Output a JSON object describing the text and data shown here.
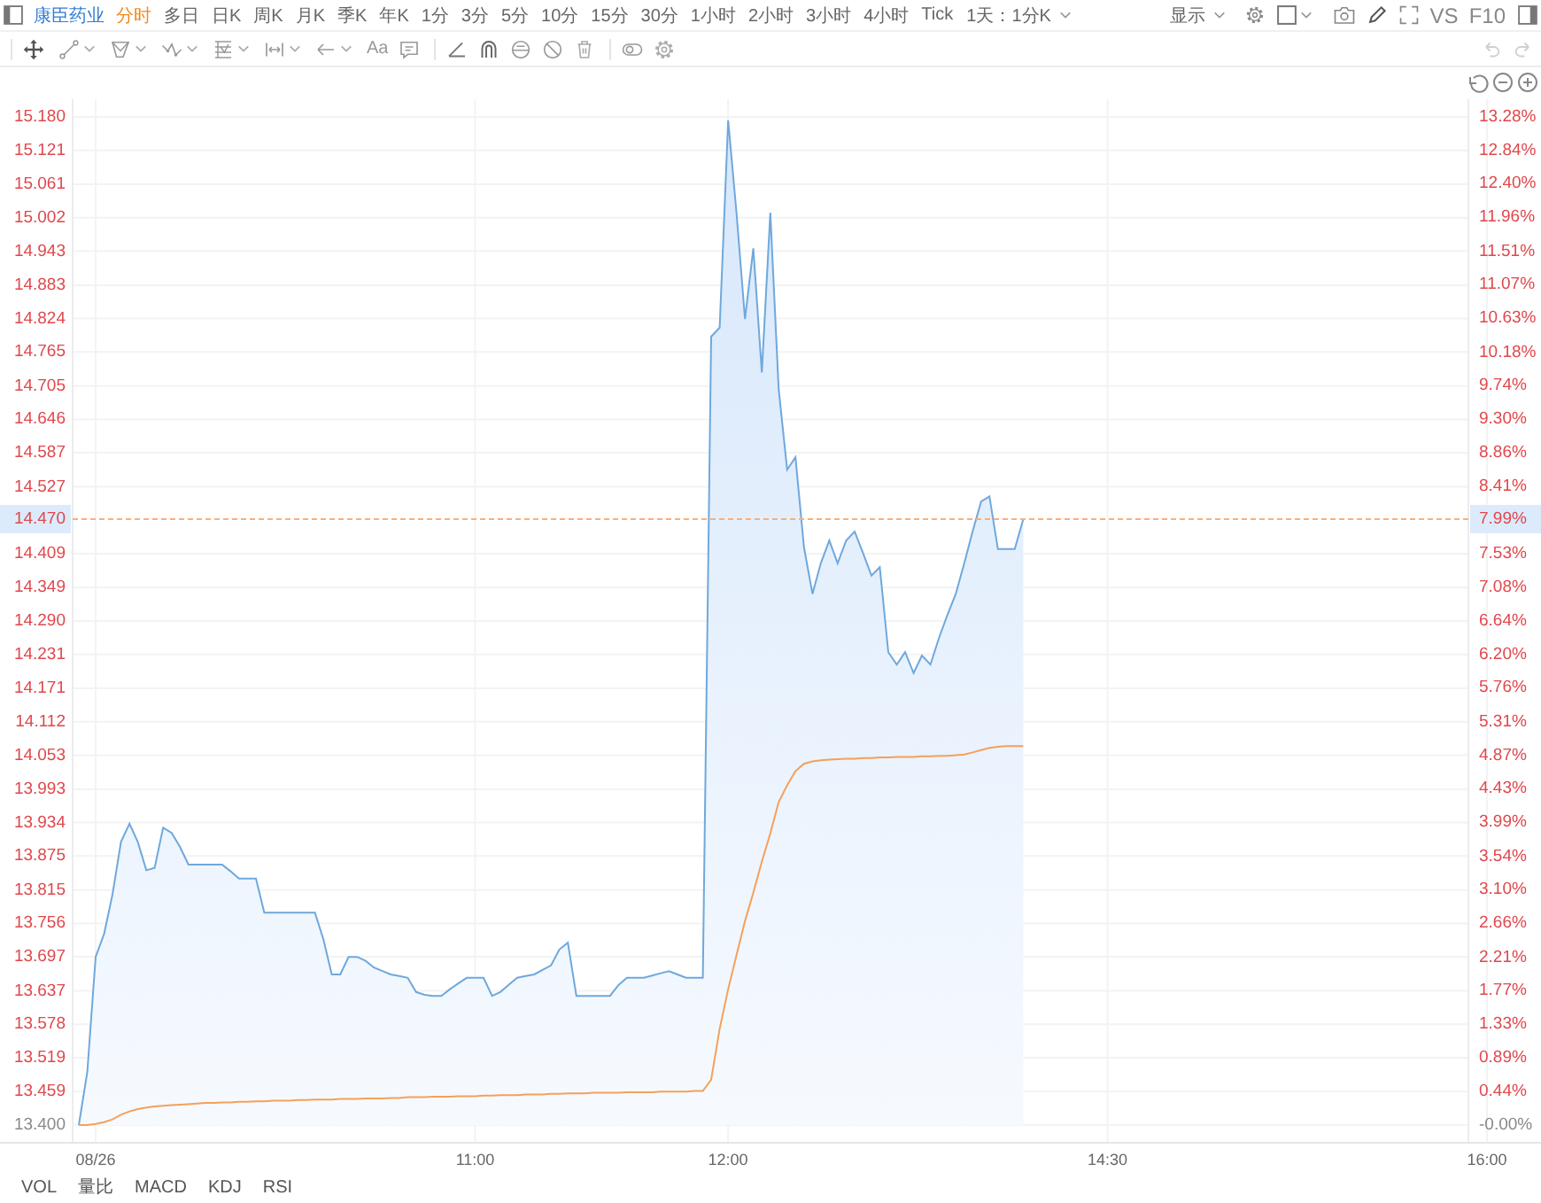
{
  "toolbar": {
    "stock_name": "康臣药业",
    "periods": [
      {
        "label": "分时",
        "selected": true
      },
      {
        "label": "多日",
        "selected": false
      },
      {
        "label": "日K",
        "selected": false
      },
      {
        "label": "周K",
        "selected": false
      },
      {
        "label": "月K",
        "selected": false
      },
      {
        "label": "季K",
        "selected": false
      },
      {
        "label": "年K",
        "selected": false
      },
      {
        "label": "1分",
        "selected": false
      },
      {
        "label": "3分",
        "selected": false
      },
      {
        "label": "5分",
        "selected": false
      },
      {
        "label": "10分",
        "selected": false
      },
      {
        "label": "15分",
        "selected": false
      },
      {
        "label": "30分",
        "selected": false
      },
      {
        "label": "1小时",
        "selected": false
      },
      {
        "label": "2小时",
        "selected": false
      },
      {
        "label": "3小时",
        "selected": false
      },
      {
        "label": "4小时",
        "selected": false
      },
      {
        "label": "Tick",
        "selected": false
      }
    ],
    "range": "1天：1分K",
    "display": "显示",
    "compare": "VS",
    "f10": "F10"
  },
  "drawing_tools": {
    "text_tool": "Aa",
    "undo": {
      "disabled": true
    },
    "redo": {
      "disabled": true
    }
  },
  "chart": {
    "last_change": "7.99%",
    "chart_data": {
      "type": "line",
      "grid": true,
      "categories": [
        null,
        null,
        "08/26",
        null,
        null,
        null,
        null,
        null,
        null,
        null,
        null,
        null,
        null,
        null,
        null,
        null,
        null,
        null,
        null,
        null,
        null,
        null,
        null,
        null,
        null,
        null,
        null,
        null,
        null,
        null,
        null,
        null,
        null,
        null,
        null,
        null,
        null,
        null,
        null,
        null,
        null,
        null,
        null,
        null,
        null,
        null,
        null,
        "11:00",
        null,
        null,
        null,
        null,
        null,
        null,
        null,
        null,
        null,
        null,
        null,
        null,
        null,
        null,
        null,
        null,
        null,
        null,
        null,
        null,
        null,
        null,
        null,
        null,
        null,
        null,
        null,
        null,
        null,
        "12:00",
        null,
        null,
        null,
        null,
        null,
        null,
        null,
        null,
        null,
        null,
        null,
        null,
        null,
        null,
        null,
        null,
        null,
        null,
        null,
        null,
        null,
        null,
        null,
        null,
        null,
        null,
        null,
        null,
        null,
        null,
        null,
        null,
        null,
        null,
        null,
        null,
        null,
        null,
        null,
        null,
        null,
        null,
        null,
        null,
        "14:30",
        null,
        null,
        null,
        null,
        null,
        null,
        null,
        null,
        null,
        null,
        null,
        null,
        null,
        null,
        null,
        null,
        null,
        null,
        null,
        null,
        null,
        null,
        null,
        null,
        null,
        null,
        null,
        null,
        null,
        null,
        null,
        null,
        null,
        null,
        null,
        null,
        null,
        null,
        null,
        null,
        null,
        null,
        null,
        null,
        "16:00"
      ],
      "series": [
        {
          "type": "area",
          "color": "#6fa8dc",
          "values": [
            13.4,
            13.494,
            13.697,
            13.738,
            13.807,
            13.9,
            13.932,
            13.9,
            13.85,
            13.854,
            13.925,
            13.916,
            13.891,
            13.86,
            13.86,
            13.86,
            13.86,
            13.86,
            13.848,
            13.835,
            13.835,
            13.835,
            13.775,
            13.775,
            13.775,
            13.775,
            13.775,
            13.775,
            13.775,
            13.728,
            13.666,
            13.666,
            13.697,
            13.697,
            13.69,
            13.678,
            13.672,
            13.666,
            13.663,
            13.66,
            13.635,
            13.63,
            13.628,
            13.628,
            13.64,
            13.65,
            13.66,
            13.66,
            13.66,
            13.628,
            13.635,
            13.648,
            13.66,
            13.663,
            13.666,
            13.674,
            13.682,
            13.71,
            13.722,
            13.628,
            13.628,
            13.628,
            13.628,
            13.628,
            13.647,
            13.66,
            13.66,
            13.66,
            13.664,
            13.668,
            13.672,
            13.666,
            13.66,
            13.66,
            13.66,
            14.792,
            14.808,
            15.174,
            15.011,
            14.823,
            14.948,
            14.729,
            15.011,
            14.7,
            14.557,
            14.579,
            14.42,
            14.338,
            14.392,
            14.432,
            14.392,
            14.432,
            14.448,
            14.41,
            14.37,
            14.385,
            14.235,
            14.213,
            14.235,
            14.198,
            14.229,
            14.213,
            14.26,
            14.3,
            14.338,
            14.392,
            14.448,
            14.501,
            14.51,
            14.417,
            14.417,
            14.417,
            14.47,
            null,
            null,
            null,
            null,
            null,
            null,
            null,
            null,
            null,
            null,
            null,
            null,
            null,
            null,
            null,
            null,
            null,
            null,
            null,
            null,
            null,
            null,
            null,
            null,
            null,
            null,
            null,
            null,
            null,
            null,
            null,
            null,
            null,
            null,
            null,
            null,
            null,
            null,
            null,
            null,
            null,
            null,
            null,
            null,
            null,
            null,
            null,
            null,
            null,
            null,
            null,
            null,
            null,
            null,
            null
          ]
        },
        {
          "color": "#f5a05a",
          "values": [
            13.4,
            13.4,
            13.402,
            13.405,
            13.41,
            13.418,
            13.424,
            13.428,
            13.431,
            13.433,
            13.434,
            13.435,
            13.436,
            13.437,
            13.438,
            13.439,
            13.439,
            13.44,
            13.44,
            13.441,
            13.441,
            13.442,
            13.442,
            13.443,
            13.443,
            13.443,
            13.444,
            13.444,
            13.445,
            13.445,
            13.445,
            13.446,
            13.446,
            13.446,
            13.447,
            13.447,
            13.447,
            13.448,
            13.448,
            13.449,
            13.449,
            13.449,
            13.45,
            13.45,
            13.45,
            13.451,
            13.451,
            13.451,
            13.452,
            13.452,
            13.453,
            13.453,
            13.453,
            13.454,
            13.454,
            13.454,
            13.455,
            13.455,
            13.456,
            13.456,
            13.456,
            13.457,
            13.457,
            13.457,
            13.457,
            13.458,
            13.458,
            13.458,
            13.458,
            13.459,
            13.459,
            13.459,
            13.459,
            13.46,
            13.46,
            13.48,
            13.57,
            13.64,
            13.7,
            13.76,
            13.81,
            13.865,
            13.915,
            13.97,
            14.0,
            14.025,
            14.038,
            14.042,
            14.044,
            14.045,
            14.046,
            14.047,
            14.047,
            14.048,
            14.048,
            14.049,
            14.049,
            14.05,
            14.05,
            14.05,
            14.051,
            14.051,
            14.052,
            14.052,
            14.053,
            14.054,
            14.058,
            14.062,
            14.066,
            14.068,
            14.069,
            14.069,
            14.069,
            null,
            null,
            null,
            null,
            null,
            null,
            null,
            null,
            null,
            null,
            null,
            null,
            null,
            null,
            null,
            null,
            null,
            null,
            null,
            null,
            null,
            null,
            null,
            null,
            null,
            null,
            null,
            null,
            null,
            null,
            null,
            null,
            null,
            null,
            null,
            null,
            null,
            null,
            null,
            null,
            null,
            null,
            null,
            null,
            null,
            null,
            null,
            null,
            null,
            null,
            null,
            null,
            null,
            null,
            null
          ]
        }
      ],
      "ylim": [
        13.4,
        15.18
      ],
      "y2lim": [
        0,
        13.28
      ],
      "yticks": [
        {
          "value": 15.18,
          "label": "15.180"
        },
        {
          "value": 15.121,
          "label": "15.121"
        },
        {
          "value": 15.061,
          "label": "15.061"
        },
        {
          "value": 15.002,
          "label": "15.002"
        },
        {
          "value": 14.943,
          "label": "14.943"
        },
        {
          "value": 14.883,
          "label": "14.883"
        },
        {
          "value": 14.824,
          "label": "14.824"
        },
        {
          "value": 14.765,
          "label": "14.765"
        },
        {
          "value": 14.705,
          "label": "14.705"
        },
        {
          "value": 14.646,
          "label": "14.646"
        },
        {
          "value": 14.587,
          "label": "14.587"
        },
        {
          "value": 14.527,
          "label": "14.527"
        },
        {
          "value": 14.409,
          "label": "14.409"
        },
        {
          "value": 14.349,
          "label": "14.349"
        },
        {
          "value": 14.29,
          "label": "14.290"
        },
        {
          "value": 14.231,
          "label": "14.231"
        },
        {
          "value": 14.171,
          "label": "14.171"
        },
        {
          "value": 14.112,
          "label": "14.112"
        },
        {
          "value": 14.053,
          "label": "14.053"
        },
        {
          "value": 13.993,
          "label": "13.993"
        },
        {
          "value": 13.934,
          "label": "13.934"
        },
        {
          "value": 13.875,
          "label": "13.875"
        },
        {
          "value": 13.815,
          "label": "13.815"
        },
        {
          "value": 13.756,
          "label": "13.756"
        },
        {
          "value": 13.697,
          "label": "13.697"
        },
        {
          "value": 13.637,
          "label": "13.637"
        },
        {
          "value": 13.578,
          "label": "13.578"
        },
        {
          "value": 13.519,
          "label": "13.519"
        },
        {
          "value": 13.459,
          "label": "13.459"
        },
        {
          "value": 13.4,
          "label": "13.400"
        }
      ],
      "y2ticks": [
        {
          "value": 13.28,
          "label": "13.28%"
        },
        {
          "value": 12.84,
          "label": "12.84%"
        },
        {
          "value": 12.4,
          "label": "12.40%"
        },
        {
          "value": 11.96,
          "label": "11.96%"
        },
        {
          "value": 11.51,
          "label": "11.51%"
        },
        {
          "value": 11.07,
          "label": "11.07%"
        },
        {
          "value": 10.63,
          "label": "10.63%"
        },
        {
          "value": 10.18,
          "label": "10.18%"
        },
        {
          "value": 9.74,
          "label": "9.74%"
        },
        {
          "value": 9.3,
          "label": "9.30%"
        },
        {
          "value": 8.86,
          "label": "8.86%"
        },
        {
          "value": 8.41,
          "label": "8.41%"
        },
        {
          "value": 7.53,
          "label": "7.53%"
        },
        {
          "value": 7.08,
          "label": "7.08%"
        },
        {
          "value": 6.64,
          "label": "6.64%"
        },
        {
          "value": 6.2,
          "label": "6.20%"
        },
        {
          "value": 5.76,
          "label": "5.76%"
        },
        {
          "value": 5.31,
          "label": "5.31%"
        },
        {
          "value": 4.87,
          "label": "4.87%"
        },
        {
          "value": 4.43,
          "label": "4.43%"
        },
        {
          "value": 3.99,
          "label": "3.99%"
        },
        {
          "value": 3.54,
          "label": "3.54%"
        },
        {
          "value": 3.1,
          "label": "3.10%"
        },
        {
          "value": 2.66,
          "label": "2.66%"
        },
        {
          "value": 2.21,
          "label": "2.21%"
        },
        {
          "value": 1.77,
          "label": "1.77%"
        },
        {
          "value": 1.33,
          "label": "1.33%"
        },
        {
          "value": 0.89,
          "label": "0.89%"
        },
        {
          "value": 0.44,
          "label": "0.44%"
        },
        {
          "value": 0,
          "label": "-0.00%"
        }
      ],
      "ref_lines": [
        {
          "axis": "y",
          "value": 14.47,
          "label": "14.470",
          "color": "#f7b07c"
        }
      ]
    }
  },
  "indicators": [
    "VOL",
    "量比",
    "MACD",
    "KDJ",
    "RSI"
  ]
}
